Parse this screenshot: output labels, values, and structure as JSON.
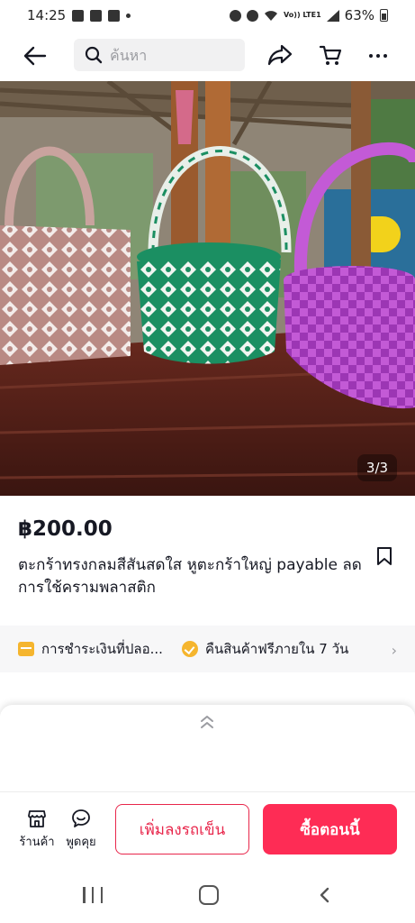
{
  "status_bar": {
    "time": "14:25",
    "battery": "63%",
    "network_label": "Vo)) LTE1"
  },
  "topnav": {
    "search_placeholder": "ค้นหา",
    "icons": [
      "back-arrow-icon",
      "search-icon",
      "share-icon",
      "cart-icon",
      "more-icon"
    ]
  },
  "product": {
    "image_counter": "3/3",
    "price": "฿200.00",
    "title": "ตะกร้าทรงกลมสีสันสดใส หูตะกร้าใหญ่ payable ลดการใช้ครามพลาสติก",
    "basket_colors": [
      "#c79a96",
      "#1f9a6a",
      "#b24bd3"
    ]
  },
  "services": {
    "payment_label": "การชำระเงินที่ปลอ...",
    "return_label": "คืนสินค้าฟรีภายใน 7 วัน"
  },
  "actions": {
    "shop_label": "ร้านค้า",
    "chat_label": "พูดคุย",
    "add_to_cart_label": "เพิ่มลงรถเข็น",
    "buy_now_label": "ซื้อตอนนี้"
  },
  "colors": {
    "accent": "#fe2c55",
    "accent_border": "#e8264b",
    "service_icon": "#f5b52e"
  }
}
